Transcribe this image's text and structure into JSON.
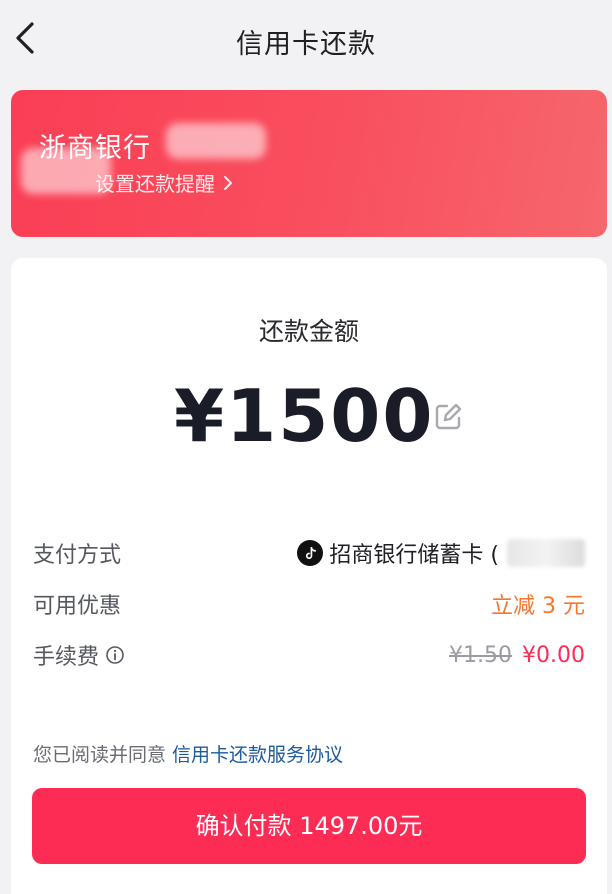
{
  "header": {
    "title": "信用卡还款",
    "back_icon": "back-arrow-icon"
  },
  "bank_card": {
    "bank_name": "浙商银行",
    "reminder_label": "设置还款提醒",
    "bg_color": "#fa3e55"
  },
  "payment": {
    "amount_label": "还款金额",
    "amount": "¥1500",
    "rows": {
      "method": {
        "label": "支付方式",
        "value": "招商银行储蓄卡 ("
      },
      "discount": {
        "label": "可用优惠",
        "value": "立减 3 元"
      },
      "fee": {
        "label": "手续费",
        "old_value": "¥1.50",
        "new_value": "¥0.00"
      }
    },
    "agreement_prefix": "您已阅读并同意",
    "agreement_link": "信用卡还款服务协议",
    "confirm_label": "确认付款 1497.00元"
  },
  "colors": {
    "accent": "#fd2c55",
    "discount": "#f5772d",
    "link": "#1d5a9e"
  }
}
